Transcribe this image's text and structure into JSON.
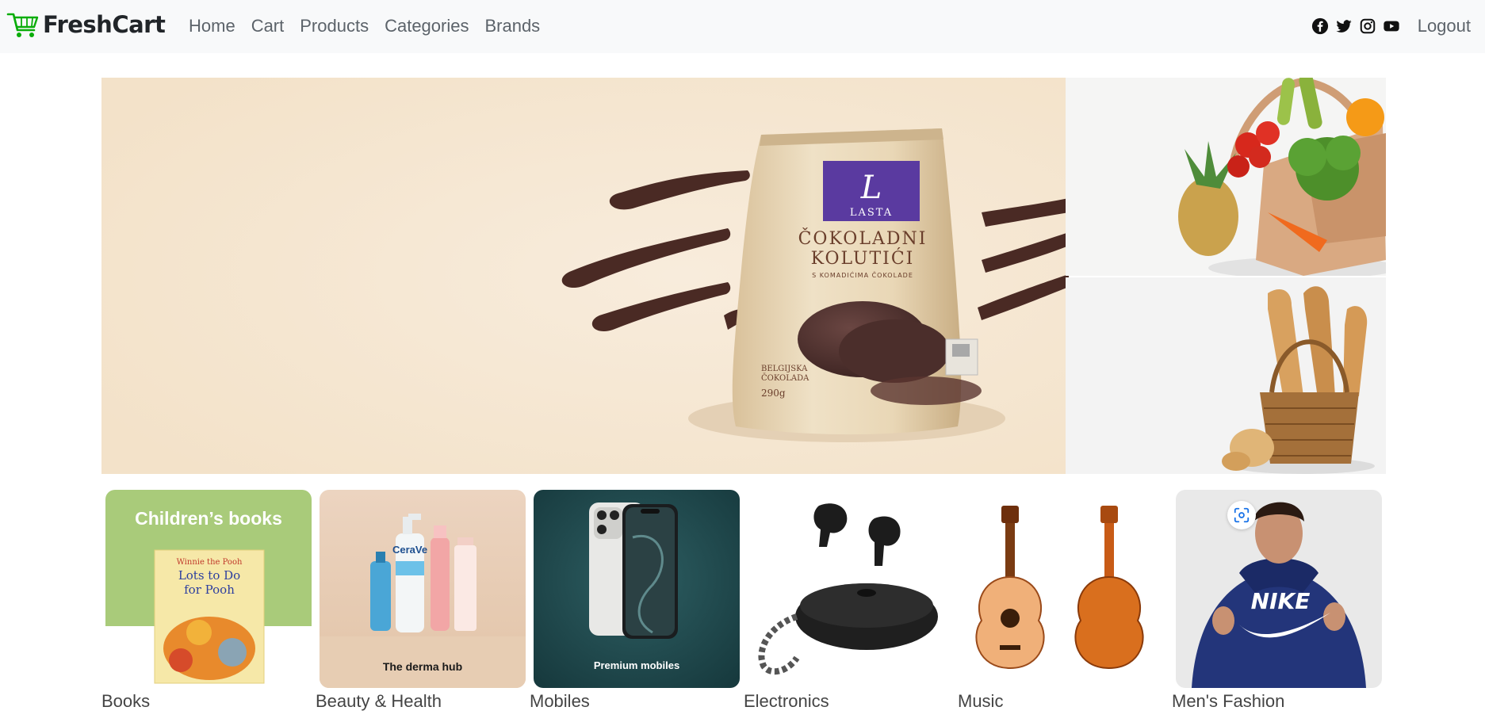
{
  "brand": {
    "name": "FreshCart",
    "accent": "#0aad0a"
  },
  "nav": {
    "links": [
      "Home",
      "Cart",
      "Products",
      "Categories",
      "Brands"
    ],
    "social": [
      "facebook-icon",
      "twitter-icon",
      "instagram-icon",
      "youtube-icon"
    ],
    "logout": "Logout"
  },
  "hero": {
    "product": {
      "brand_mark": "L",
      "brand_name": "LASTA",
      "title_line1": "ČOKOLADNI",
      "title_line2": "KOLUTIĆI",
      "subtitle": "S KOMADIĆIMA ČOKOLADE",
      "origin_line1": "BELGIJSKA",
      "origin_line2": "ČOKOLADA",
      "weight": "290g"
    }
  },
  "categories": [
    {
      "name": "Books",
      "banner": "Children’s books",
      "book_title_1": "Winnie the Pooh",
      "book_title_2": "Lots to Do",
      "book_title_3": "for Pooh"
    },
    {
      "name": "Beauty & Health",
      "banner": "The derma hub"
    },
    {
      "name": "Mobiles",
      "banner": "Premium mobiles"
    },
    {
      "name": "Electronics"
    },
    {
      "name": "Music"
    },
    {
      "name": "Men's Fashion",
      "shirt_text": "NIKE"
    }
  ]
}
